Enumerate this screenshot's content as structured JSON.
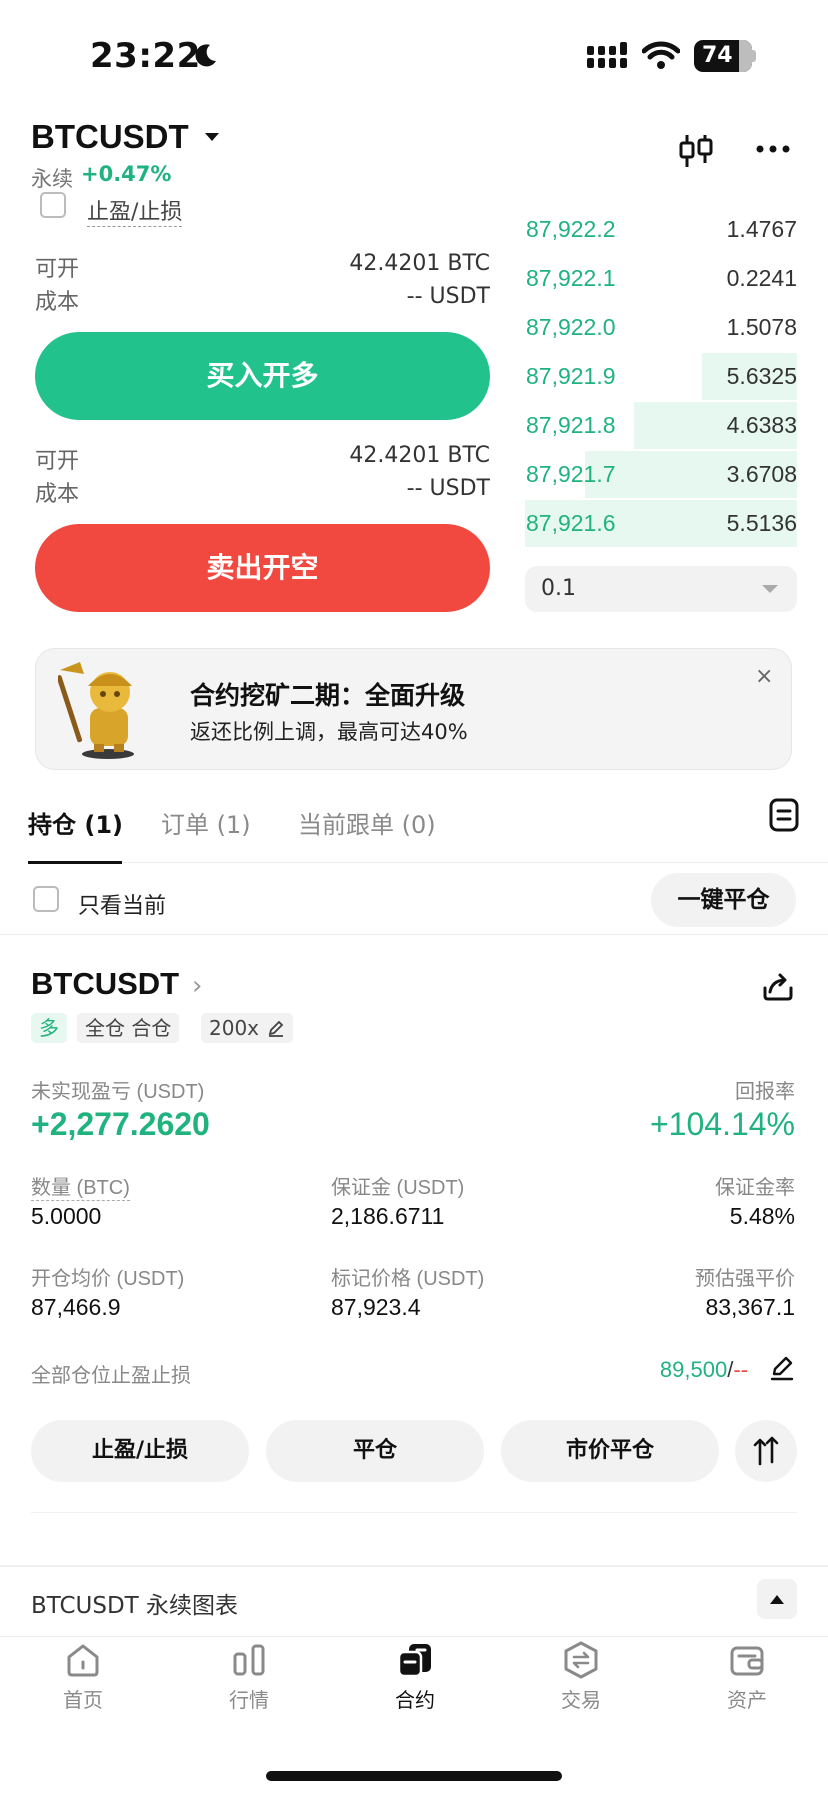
{
  "status_bar": {
    "time": "23:22",
    "battery": "74"
  },
  "header": {
    "symbol": "BTCUSDT",
    "type": "永续",
    "change": "+0.47%"
  },
  "order_form": {
    "tpsl_label": "止盈/止损",
    "long": {
      "available_label": "可开",
      "available_value": "42.4201 BTC",
      "cost_label": "成本",
      "cost_value": "-- USDT",
      "button": "买入开多"
    },
    "short": {
      "available_label": "可开",
      "available_value": "42.4201 BTC",
      "cost_label": "成本",
      "cost_value": "-- USDT",
      "button": "卖出开空"
    }
  },
  "order_book": {
    "rows": [
      {
        "price": "87,922.2",
        "qty": "1.4767",
        "depth": 0.0
      },
      {
        "price": "87,922.1",
        "qty": "0.2241",
        "depth": 0.0
      },
      {
        "price": "87,922.0",
        "qty": "1.5078",
        "depth": 0.0
      },
      {
        "price": "87,921.9",
        "qty": "5.6325",
        "depth": 0.35
      },
      {
        "price": "87,921.8",
        "qty": "4.6383",
        "depth": 0.6
      },
      {
        "price": "87,921.7",
        "qty": "3.6708",
        "depth": 0.78
      },
      {
        "price": "87,921.6",
        "qty": "5.5136",
        "depth": 1.0
      }
    ],
    "precision": "0.1"
  },
  "banner": {
    "title": "合约挖矿二期：全面升级",
    "subtitle": "返还比例上调，最高可达40%",
    "close": "×"
  },
  "tabs": {
    "positions": "持仓 (1)",
    "orders": "订单 (1)",
    "copy": "当前跟单 (0)"
  },
  "filter": {
    "only_current": "只看当前",
    "close_all": "一键平仓"
  },
  "position": {
    "symbol": "BTCUSDT",
    "side": "多",
    "margin_mode": "全仓 合仓",
    "leverage": "200x",
    "pnl_label": "未实现盈亏 (USDT)",
    "pnl_value": "+2,277.2620",
    "roe_label": "回报率",
    "roe_value": "+104.14%",
    "qty_label": "数量 (BTC)",
    "qty_value": "5.0000",
    "margin_label": "保证金 (USDT)",
    "margin_value": "2,186.6711",
    "margin_ratio_label": "保证金率",
    "margin_ratio_value": "5.48%",
    "entry_label": "开仓均价 (USDT)",
    "entry_value": "87,466.9",
    "mark_label": "标记价格 (USDT)",
    "mark_value": "87,923.4",
    "liq_label": "预估强平价",
    "liq_value": "83,367.1",
    "tpsl_all_label": "全部仓位止盈止损",
    "tp_value": "89,500",
    "slash": "/",
    "sl_value": "--",
    "btn_tpsl": "止盈/止损",
    "btn_close": "平仓",
    "btn_market_close": "市价平仓"
  },
  "chart_section": {
    "title": "BTCUSDT 永续图表"
  },
  "nav": {
    "home": "首页",
    "market": "行情",
    "futures": "合约",
    "trade": "交易",
    "assets": "资产"
  }
}
